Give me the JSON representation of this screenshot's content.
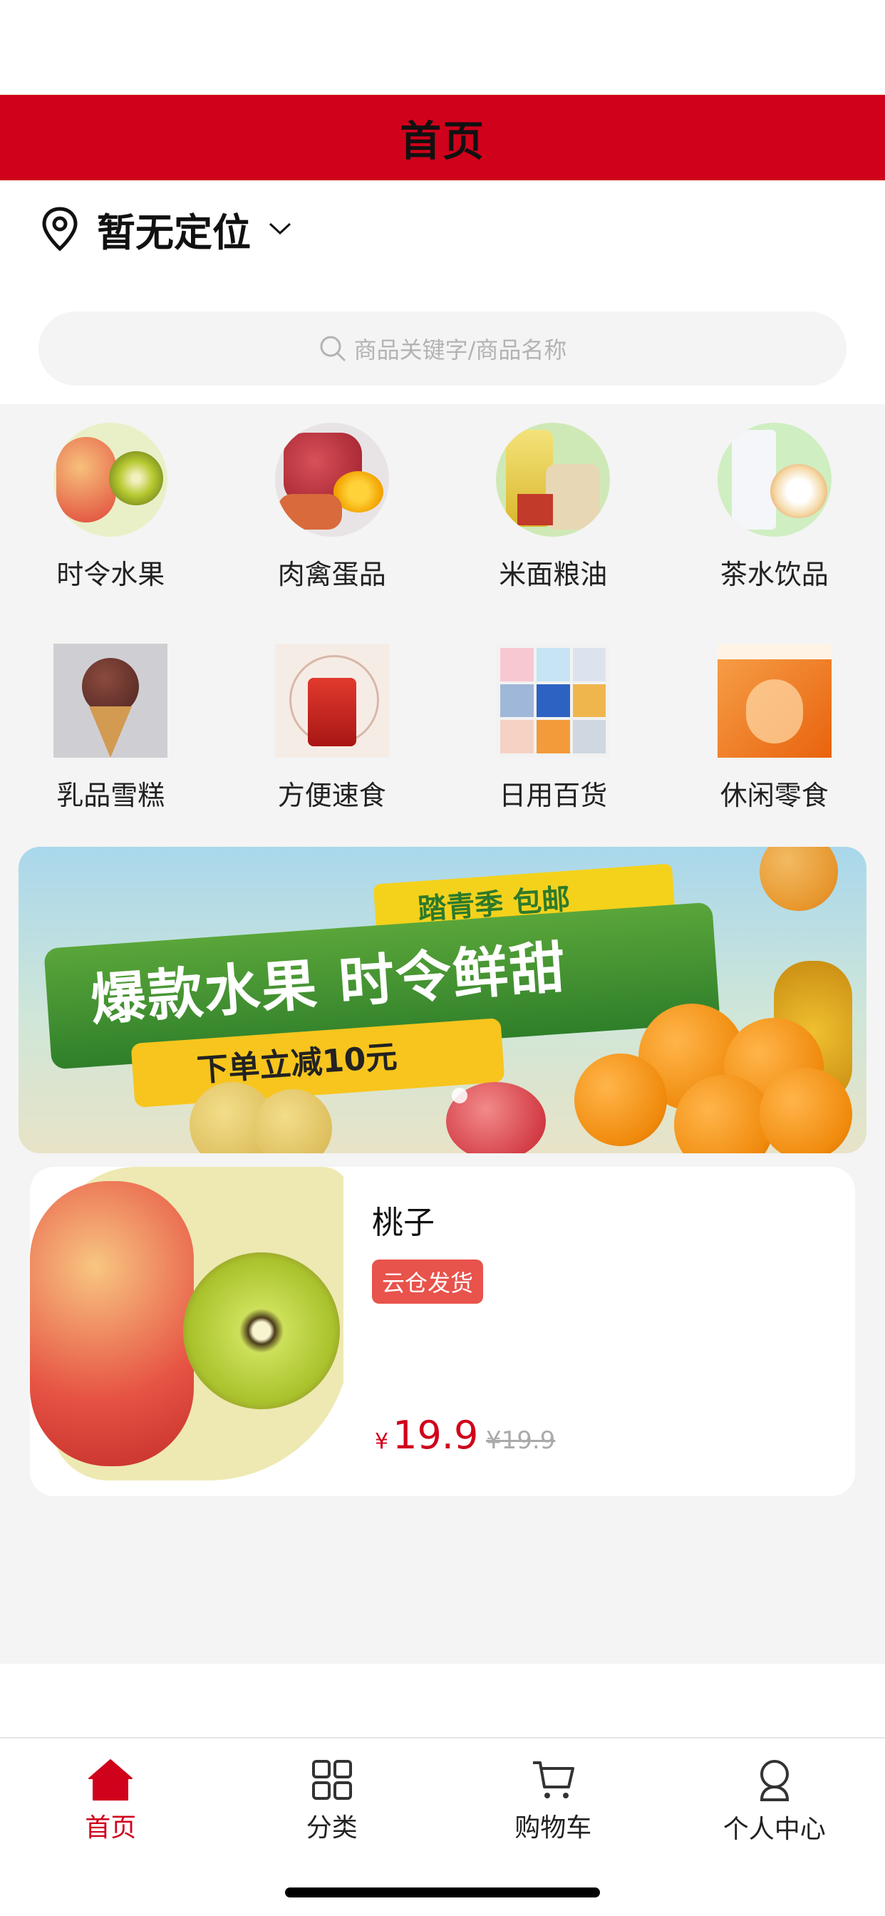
{
  "header": {
    "title": "首页"
  },
  "location": {
    "label": "暂无定位"
  },
  "search": {
    "placeholder": "商品关键字/商品名称"
  },
  "categories": [
    {
      "label": "时令水果",
      "icon": "fruit-icon"
    },
    {
      "label": "肉禽蛋品",
      "icon": "meat-egg-icon"
    },
    {
      "label": "米面粮油",
      "icon": "grain-oil-icon"
    },
    {
      "label": "茶水饮品",
      "icon": "drinks-icon"
    },
    {
      "label": "乳品雪糕",
      "icon": "ice-cream-icon"
    },
    {
      "label": "方便速食",
      "icon": "instant-food-icon"
    },
    {
      "label": "日用百货",
      "icon": "daily-goods-icon"
    },
    {
      "label": "休闲零食",
      "icon": "snacks-icon"
    }
  ],
  "banner": {
    "tag": "踏青季 包邮",
    "headline": "爆款水果 时令鲜甜",
    "subline": "下单立减10元"
  },
  "product": {
    "name": "桃子",
    "badge": "云仓发货",
    "price_symbol": "¥",
    "price": "19.9",
    "original_price": "¥19.9"
  },
  "tabbar": [
    {
      "label": "首页",
      "icon": "home-icon",
      "active": true
    },
    {
      "label": "分类",
      "icon": "grid-icon",
      "active": false
    },
    {
      "label": "购物车",
      "icon": "cart-icon",
      "active": false
    },
    {
      "label": "个人中心",
      "icon": "user-icon",
      "active": false
    }
  ],
  "colors": {
    "brand_red": "#d0011b",
    "badge_red": "#e8534c",
    "background_grey": "#f4f4f4"
  }
}
